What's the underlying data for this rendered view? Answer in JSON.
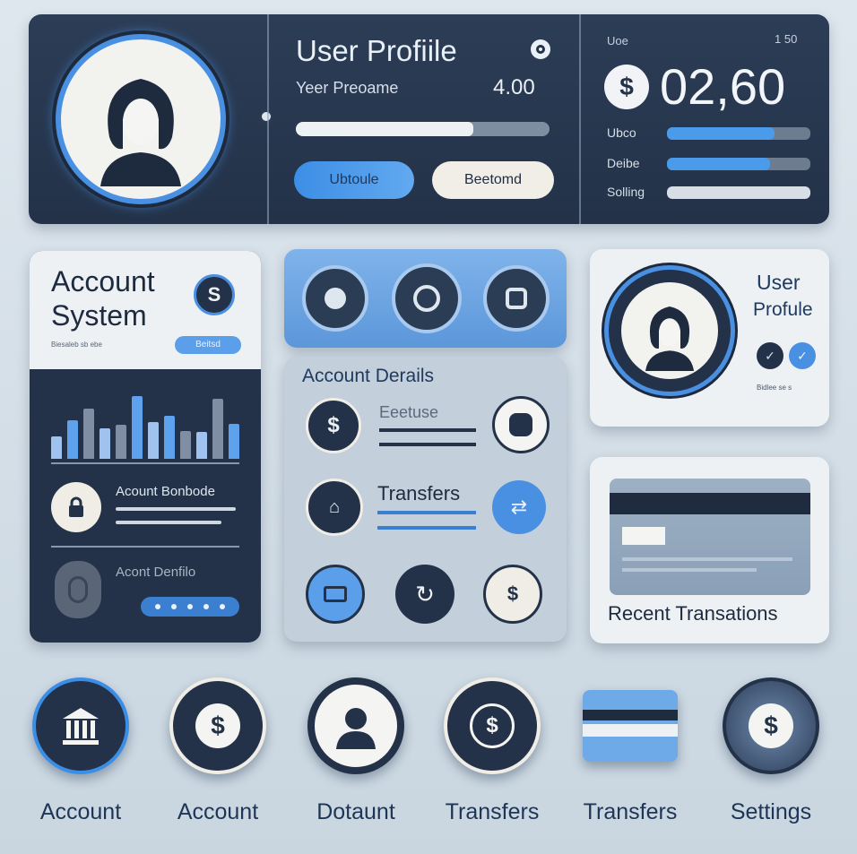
{
  "profile": {
    "title": "User Profiile",
    "subtitle": "Yeer Preoame",
    "value": "4.00",
    "progress": 0.7,
    "primary_button": "Ubtoule",
    "secondary_button": "Beetomd"
  },
  "balance": {
    "label_top": "Uoe",
    "label_top_right": "1 50",
    "amount": "02,60",
    "rows": [
      {
        "label": "Ubco",
        "progress": 0.75
      },
      {
        "label": "Deibe",
        "progress": 0.72
      },
      {
        "label": "Solling",
        "progress": 1.0
      }
    ]
  },
  "account_system": {
    "title_line1": "Account",
    "title_line2": "System",
    "badge": "Beitsd",
    "caption": "Biesaleb sb ebe",
    "chart_bars": [
      0.3,
      0.52,
      0.68,
      0.42,
      0.46,
      0.85,
      0.5,
      0.58,
      0.38,
      0.36,
      0.82,
      0.48
    ],
    "item1_label": "Acount Bonbode",
    "item2_label": "Acont Denfilo"
  },
  "account_details": {
    "title": "Account Derails",
    "row1_label": "Eeetuse",
    "row2_label": "Transfers"
  },
  "user_profile_card": {
    "title_line1": "User",
    "title_line2": "Profule",
    "caption": "Bidlee se s"
  },
  "recent": {
    "title": "Recent Transations"
  },
  "bottom_icons": [
    {
      "label": "Account",
      "icon": "bank-icon"
    },
    {
      "label": "Account",
      "icon": "dollar-icon"
    },
    {
      "label": "Dotaunt",
      "icon": "user-icon"
    },
    {
      "label": "Transfers",
      "icon": "target-dollar-icon"
    },
    {
      "label": "Transfers",
      "icon": "card-icon"
    },
    {
      "label": "Settings",
      "icon": "dollar-icon"
    }
  ],
  "colors": {
    "navy": "#233248",
    "accent": "#4a90e2",
    "light_blue": "#6fa8e8"
  }
}
